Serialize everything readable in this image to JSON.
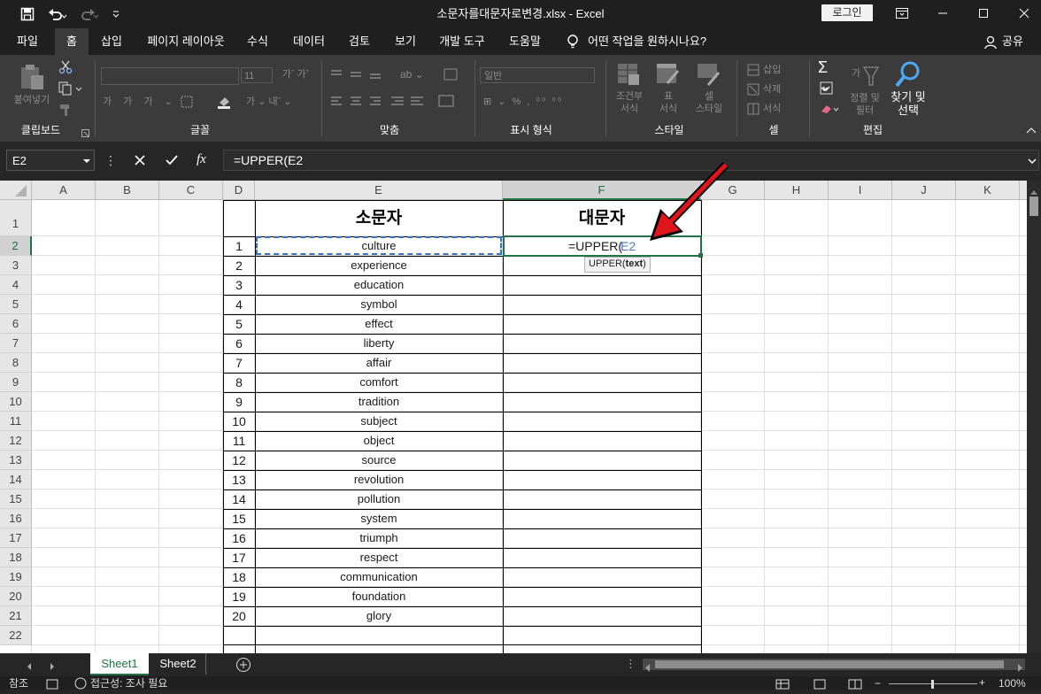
{
  "window": {
    "title": "소문자를대문자로변경.xlsx  -  Excel",
    "login_label": "로그인",
    "minimize": "—",
    "restore": "☐",
    "close": "✕",
    "ribbon_display": "⊡"
  },
  "quick_access": {
    "save": "💾",
    "undo": "↶",
    "redo": "↷",
    "customize": "⌄"
  },
  "menu": {
    "tabs": [
      "파일",
      "홈",
      "삽입",
      "페이지 레이아웃",
      "수식",
      "데이터",
      "검토",
      "보기",
      "개발 도구",
      "도움말"
    ],
    "active": "홈",
    "tell_me": "어떤 작업을 원하시나요?",
    "share": "공유"
  },
  "ribbon": {
    "clipboard": {
      "label": "클립보드",
      "paste": "붙여넣기"
    },
    "font": {
      "label": "글꼴",
      "size": "11"
    },
    "alignment": {
      "label": "맞춤"
    },
    "number": {
      "label": "표시 형식",
      "format": "일반"
    },
    "styles": {
      "label": "스타일",
      "conditional": "조건부\n서식",
      "table": "표\n서식",
      "cell_style": "셀\n스타일"
    },
    "cells": {
      "label": "셀",
      "insert": "삽입",
      "delete": "삭제",
      "format": "서식"
    },
    "editing": {
      "label": "편집",
      "sort": "정렬 및\n필터",
      "find": "찾기 및\n선택"
    }
  },
  "formula_bar": {
    "name_box": "E2",
    "cancel": "✕",
    "enter": "✓",
    "fx": "fx",
    "formula": "=UPPER(E2"
  },
  "columns": [
    "A",
    "B",
    "C",
    "D",
    "E",
    "F",
    "G",
    "H",
    "I",
    "J",
    "K"
  ],
  "rows": [
    "1",
    "2",
    "3",
    "4",
    "5",
    "6",
    "7",
    "8",
    "9",
    "10",
    "11",
    "12",
    "13",
    "14",
    "15",
    "16",
    "17",
    "18",
    "19",
    "20",
    "21",
    "22"
  ],
  "table": {
    "header_lower": "소문자",
    "header_upper": "대문자",
    "numbers": [
      "1",
      "2",
      "3",
      "4",
      "5",
      "6",
      "7",
      "8",
      "9",
      "10",
      "11",
      "12",
      "13",
      "14",
      "15",
      "16",
      "17",
      "18",
      "19",
      "20"
    ],
    "words": [
      "culture",
      "experience",
      "education",
      "symbol",
      "effect",
      "liberty",
      "affair",
      "comfort",
      "tradition",
      "subject",
      "object",
      "source",
      "revolution",
      "pollution",
      "system",
      "triumph",
      "respect",
      "communication",
      "foundation",
      "glory"
    ]
  },
  "editing_cell": {
    "prefix": "=UPPER(",
    "ref": "E2"
  },
  "tooltip": {
    "fn": "UPPER(",
    "arg": "text",
    ")": ")"
  },
  "sheets": {
    "tabs": [
      "Sheet1",
      "Sheet2"
    ],
    "active": "Sheet1",
    "add": "⊕"
  },
  "status": {
    "mode": "참조",
    "accessibility": "접근성: 조사 필요",
    "zoom": "100%"
  },
  "colors": {
    "excel_green": "#217346",
    "arrow": "#e0141b",
    "ref_blue": "#4a78c2"
  }
}
